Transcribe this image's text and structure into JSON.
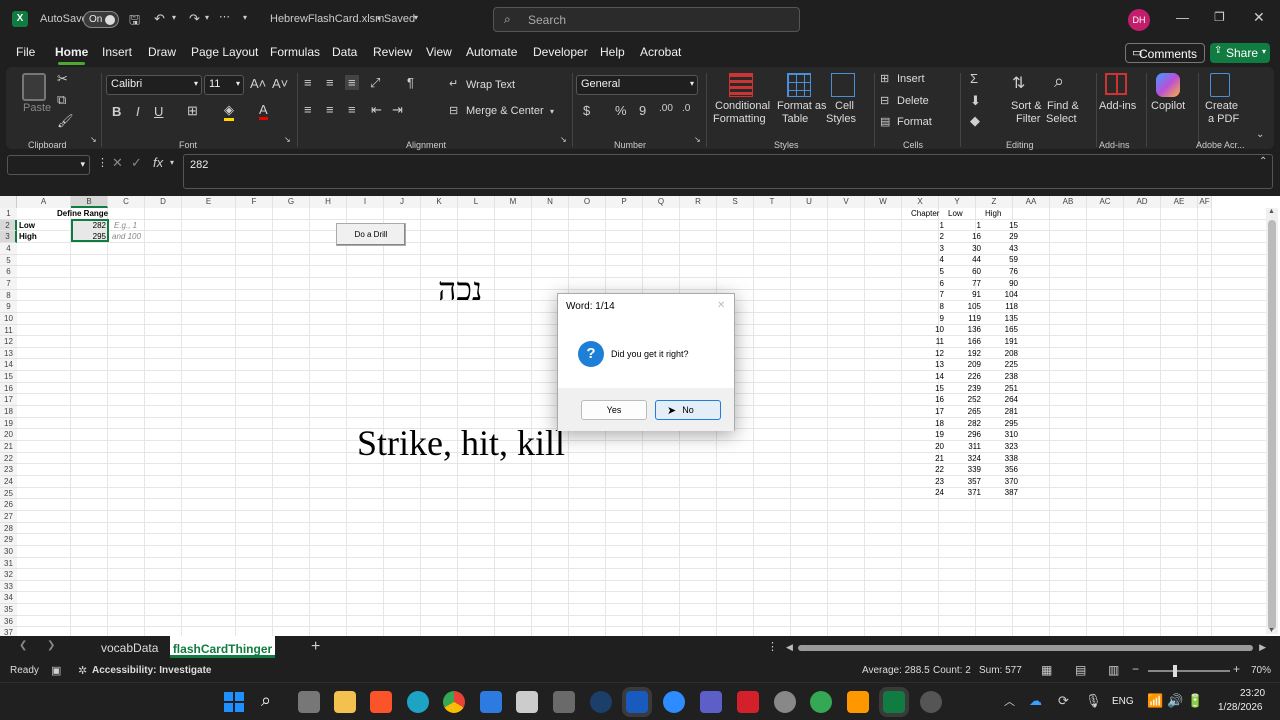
{
  "title": {
    "autosave_label": "AutoSave",
    "autosave_state": "On",
    "filename": "HebrewFlashCard.xlsm",
    "save_status": "• Saved",
    "search_placeholder": "Search",
    "avatar": "DH"
  },
  "menu": [
    "File",
    "Home",
    "Insert",
    "Draw",
    "Page Layout",
    "Formulas",
    "Data",
    "Review",
    "View",
    "Automate",
    "Developer",
    "Help",
    "Acrobat"
  ],
  "menu_right": {
    "comments": "Comments",
    "share": "Share"
  },
  "ribbon": {
    "clipboard": {
      "paste": "Paste",
      "group": "Clipboard"
    },
    "font": {
      "name": "Calibri",
      "size": "11",
      "bold": "B",
      "italic": "I",
      "underline": "U",
      "group": "Font"
    },
    "alignment": {
      "wrap": "Wrap Text",
      "merge": "Merge & Center",
      "group": "Alignment"
    },
    "number": {
      "format": "General",
      "group": "Number"
    },
    "styles": {
      "cond1": "Conditional",
      "cond2": "Formatting",
      "fmt1": "Format as",
      "fmt2": "Table",
      "cell1": "Cell",
      "cell2": "Styles",
      "group": "Styles"
    },
    "cells": {
      "insert": "Insert",
      "delete": "Delete",
      "format": "Format",
      "group": "Cells"
    },
    "editing": {
      "sort1": "Sort &",
      "sort2": "Filter",
      "find1": "Find &",
      "find2": "Select",
      "group": "Editing"
    },
    "addins": {
      "label": "Add-ins",
      "group": "Add-ins"
    },
    "copilot": {
      "label": "Copilot"
    },
    "acrobat": {
      "l1": "Create",
      "l2": "a PDF",
      "group": "Adobe Acr..."
    }
  },
  "formula_bar": {
    "value": "282",
    "fx": "fx"
  },
  "columns": [
    "A",
    "B",
    "C",
    "D",
    "E",
    "F",
    "G",
    "H",
    "I",
    "J",
    "K",
    "L",
    "M",
    "N",
    "O",
    "P",
    "Q",
    "R",
    "S",
    "T",
    "U",
    "V",
    "W",
    "X",
    "Y",
    "Z",
    "AA",
    "AB",
    "AC",
    "AD",
    "AE",
    "AF"
  ],
  "rows": [
    "1",
    "2",
    "3",
    "4",
    "5",
    "6",
    "7",
    "8",
    "9",
    "10",
    "11",
    "12",
    "13",
    "14",
    "15",
    "16",
    "17",
    "18",
    "19",
    "20",
    "21",
    "22",
    "23",
    "24",
    "25",
    "26",
    "27",
    "28",
    "29",
    "30",
    "31",
    "32",
    "33",
    "34",
    "35",
    "36",
    "37"
  ],
  "cells": {
    "define_range": "Define Range",
    "low": "Low",
    "high": "High",
    "low_val": "282",
    "high_val": "295",
    "hint1": "E.g., 1",
    "hint2": "and 100",
    "drill_button": "Do a Drill",
    "hebrew_word": "נכה",
    "english_word": "Strike, hit, kill"
  },
  "chapter_table": {
    "headers": [
      "Chapter",
      "Low",
      "High"
    ],
    "rows": [
      [
        "1",
        "1",
        "15"
      ],
      [
        "2",
        "16",
        "29"
      ],
      [
        "3",
        "30",
        "43"
      ],
      [
        "4",
        "44",
        "59"
      ],
      [
        "5",
        "60",
        "76"
      ],
      [
        "6",
        "77",
        "90"
      ],
      [
        "7",
        "91",
        "104"
      ],
      [
        "8",
        "105",
        "118"
      ],
      [
        "9",
        "119",
        "135"
      ],
      [
        "10",
        "136",
        "165"
      ],
      [
        "11",
        "166",
        "191"
      ],
      [
        "12",
        "192",
        "208"
      ],
      [
        "13",
        "209",
        "225"
      ],
      [
        "14",
        "226",
        "238"
      ],
      [
        "15",
        "239",
        "251"
      ],
      [
        "16",
        "252",
        "264"
      ],
      [
        "17",
        "265",
        "281"
      ],
      [
        "18",
        "282",
        "295"
      ],
      [
        "19",
        "296",
        "310"
      ],
      [
        "20",
        "311",
        "323"
      ],
      [
        "21",
        "324",
        "338"
      ],
      [
        "22",
        "339",
        "356"
      ],
      [
        "23",
        "357",
        "370"
      ],
      [
        "24",
        "371",
        "387"
      ]
    ]
  },
  "dialog": {
    "title": "Word: 1/14",
    "message": "Did you get it right?",
    "yes": "Yes",
    "no": "No",
    "close": "✕"
  },
  "sheet_tabs": [
    "vocabData",
    "flashCardThinger"
  ],
  "status": {
    "ready": "Ready",
    "accessibility": "Accessibility: Investigate",
    "average": "Average: 288.5",
    "count": "Count: 2",
    "sum": "Sum: 577",
    "zoom": "70%"
  },
  "taskbar": {
    "lang": "ENG",
    "time": "23:20",
    "date": "1/28/2026"
  },
  "colors": {
    "accent": "#4ea72e",
    "excel_green": "#107c41",
    "dialog_blue": "#1e7fd6"
  }
}
